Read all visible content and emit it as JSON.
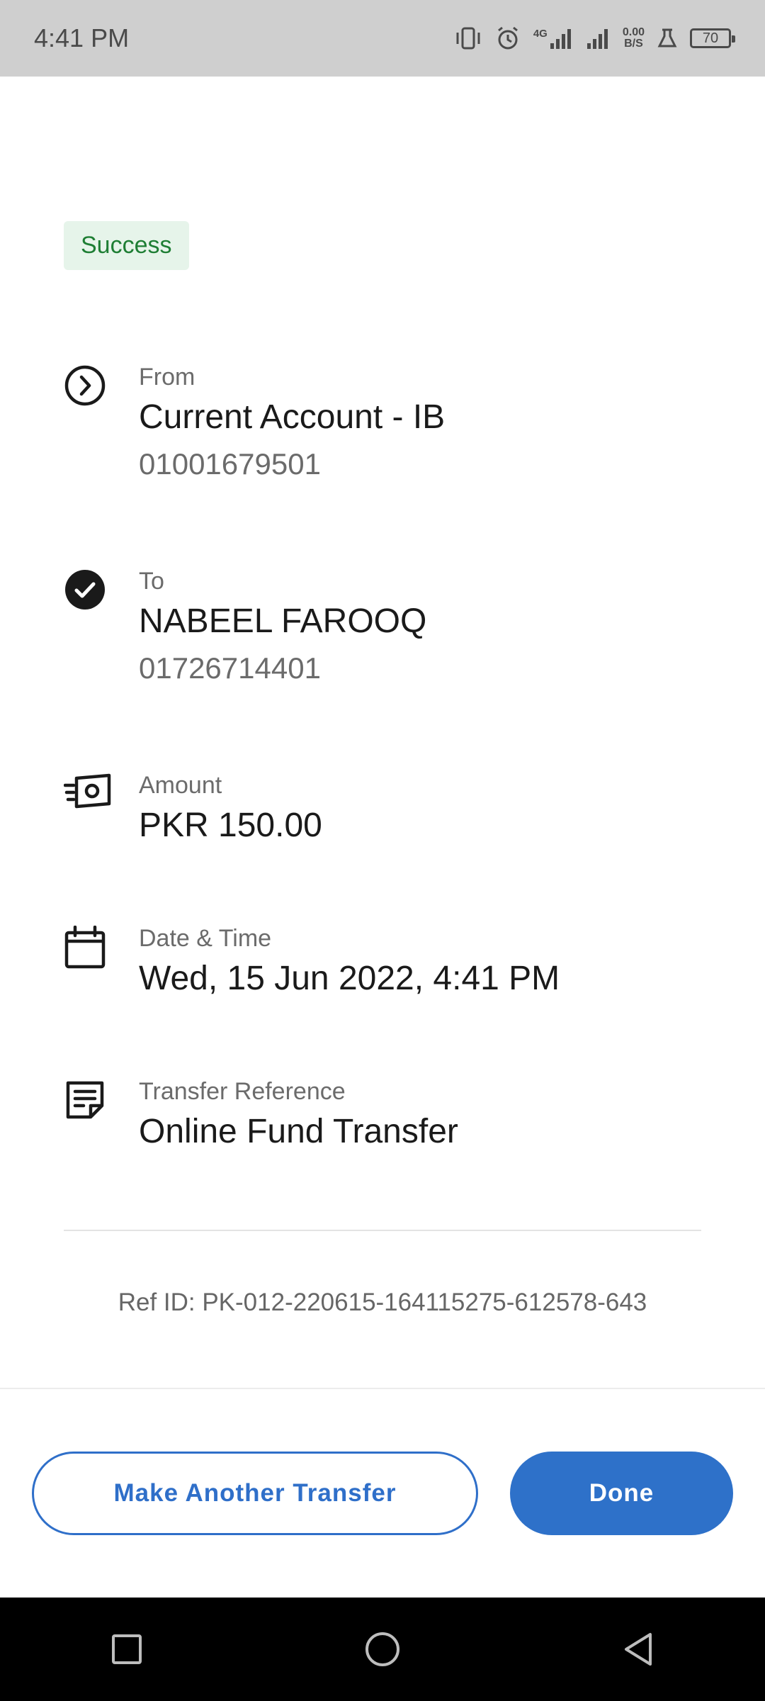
{
  "status_bar": {
    "time": "4:41 PM",
    "network": "4G",
    "net_speed_value": "0.00",
    "net_speed_unit": "B/S",
    "battery": "70"
  },
  "status_badge": "Success",
  "from": {
    "label": "From",
    "name": "Current Account - IB",
    "account": "01001679501"
  },
  "to": {
    "label": "To",
    "name": "NABEEL FAROOQ",
    "account": "01726714401"
  },
  "amount": {
    "label": "Amount",
    "value": "PKR 150.00"
  },
  "datetime": {
    "label": "Date & Time",
    "value": "Wed, 15 Jun 2022, 4:41 PM"
  },
  "reference": {
    "label": "Transfer Reference",
    "value": "Online Fund Transfer"
  },
  "ref_id": "Ref ID: PK-012-220615-164115275-612578-643",
  "buttons": {
    "another": "Make Another Transfer",
    "done": "Done"
  },
  "colors": {
    "accent": "#2e71c9",
    "success_bg": "#e6f4ea",
    "success_text": "#1e7e34"
  },
  "icons": [
    "vibrate-icon",
    "alarm-icon",
    "signal-icon",
    "flask-icon",
    "battery-icon",
    "chevron-circle-icon",
    "check-circle-icon",
    "money-icon",
    "calendar-icon",
    "note-icon",
    "square-icon",
    "circle-icon",
    "back-triangle-icon"
  ]
}
